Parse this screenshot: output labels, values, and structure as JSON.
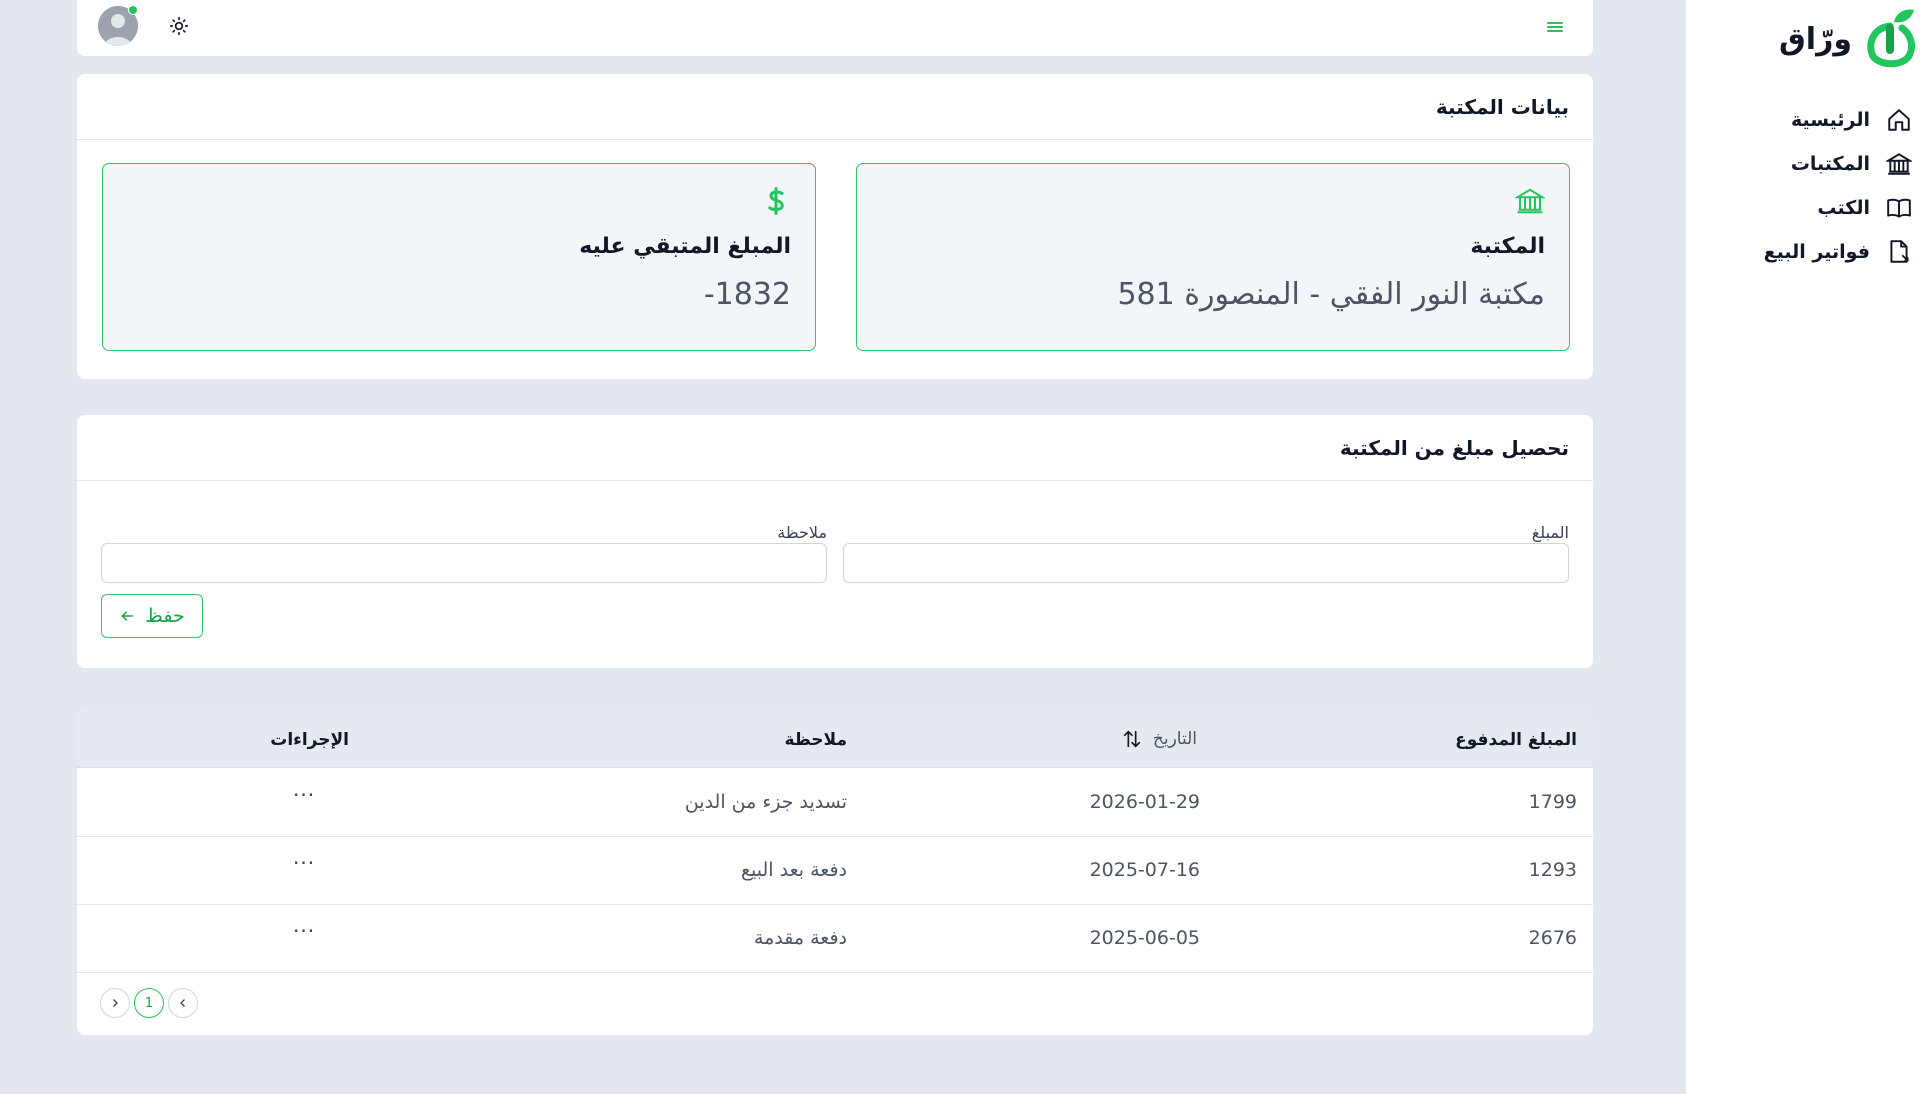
{
  "brand": {
    "name": "ورّاق",
    "accent": "#22c55e"
  },
  "sidebar": {
    "items": [
      {
        "label": "الرئيسية",
        "icon": "home-icon"
      },
      {
        "label": "المكتبات",
        "icon": "bank-icon"
      },
      {
        "label": "الكتب",
        "icon": "book-icon"
      },
      {
        "label": "فواتير البيع",
        "icon": "document-icon"
      }
    ]
  },
  "topbar": {
    "menu_icon": "hamburger-icon",
    "theme_icon": "sun-icon",
    "avatar_status": "online"
  },
  "library_info": {
    "title": "بيانات المكتبة",
    "library_label": "المكتبة",
    "library_name": "مكتبة النور الفقي - المنصورة 581",
    "balance_label": "المبلغ المتبقي عليه",
    "balance_value": "1832-"
  },
  "collect_form": {
    "title": "تحصيل مبلغ من المكتبة",
    "amount_label": "المبلغ",
    "amount_value": "",
    "note_label": "ملاحظة",
    "note_value": "",
    "save_label": "حفظ"
  },
  "payments_table": {
    "headers": {
      "amount": "المبلغ المدفوع",
      "date": "التاريخ",
      "note": "ملاحظة",
      "actions": "الإجراءات"
    },
    "rows": [
      {
        "amount": "1799",
        "date": "2026-01-29",
        "note": "تسديد جزء من الدين",
        "actions": "···"
      },
      {
        "amount": "1293",
        "date": "2025-07-16",
        "note": "دفعة بعد البيع",
        "actions": "···"
      },
      {
        "amount": "2676",
        "date": "2025-06-05",
        "note": "دفعة مقدمة",
        "actions": "···"
      }
    ],
    "pagination": {
      "current_page": "1"
    }
  }
}
